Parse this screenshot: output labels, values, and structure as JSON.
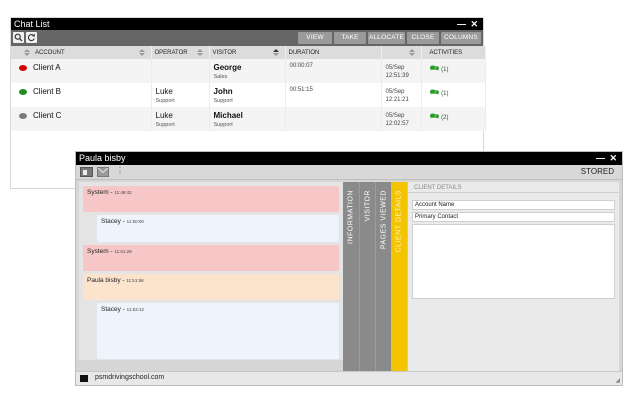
{
  "chat_list": {
    "title": "Chat List",
    "toolbar": {
      "view": "VIEW",
      "take": "TAKE",
      "allocate": "ALLOCATE",
      "close": "CLOSE",
      "columns": "COLUMNS"
    },
    "columns": {
      "account": "ACCOUNT",
      "operator": "OPERATOR",
      "visitor": "VISITOR",
      "duration": "DURATION",
      "activities": "ACTIVITIES"
    },
    "rows": [
      {
        "status_color": "#d10000",
        "account": "Client A",
        "operator": "",
        "operator_dept": "",
        "visitor": "George",
        "visitor_dept": "Sales",
        "duration": "00:00:07",
        "date": "05/Sep",
        "time": "12:51:39",
        "activities": "(1)"
      },
      {
        "status_color": "#1e8c1e",
        "account": "Client B",
        "operator": "Luke",
        "operator_dept": "Support",
        "visitor": "John",
        "visitor_dept": "Support",
        "duration": "00:51:15",
        "date": "05/Sep",
        "time": "12:21:21",
        "activities": "(1)"
      },
      {
        "status_color": "#7a7a7a",
        "account": "Client C",
        "operator": "Luke",
        "operator_dept": "Support",
        "visitor": "Michael",
        "visitor_dept": "Support",
        "duration": "",
        "date": "05/Sep",
        "time": "12:02:57",
        "activities": "(2)"
      }
    ]
  },
  "chat_window": {
    "title": "Paula bisby",
    "status": "STORED",
    "messages": [
      {
        "sender": "System",
        "time": "11:49:42"
      },
      {
        "sender": "Stacey",
        "time": "11:50:00"
      },
      {
        "sender": "System",
        "time": "11:51:29"
      },
      {
        "sender": "Paula bisby",
        "time": "11:51:58"
      },
      {
        "sender": "Stacey",
        "time": "11:53:12"
      }
    ],
    "tabs": [
      "INFORMATION",
      "VISITOR",
      "PAGES VIEWED",
      "CLIENT DETAILS"
    ],
    "client_details": {
      "header": "CLIENT DETAILS",
      "account_name": "Account Name",
      "primary_contact": "Primary Contact"
    },
    "footer_site": "psmdrivingschool.com"
  },
  "colors": {
    "accent_tab": "#f5c400",
    "tab_gray": "#8a8a8a",
    "system_msg": "#f7c7c7",
    "visitor_msg": "#fce3cc",
    "operator_msg": "#eef4fb"
  }
}
